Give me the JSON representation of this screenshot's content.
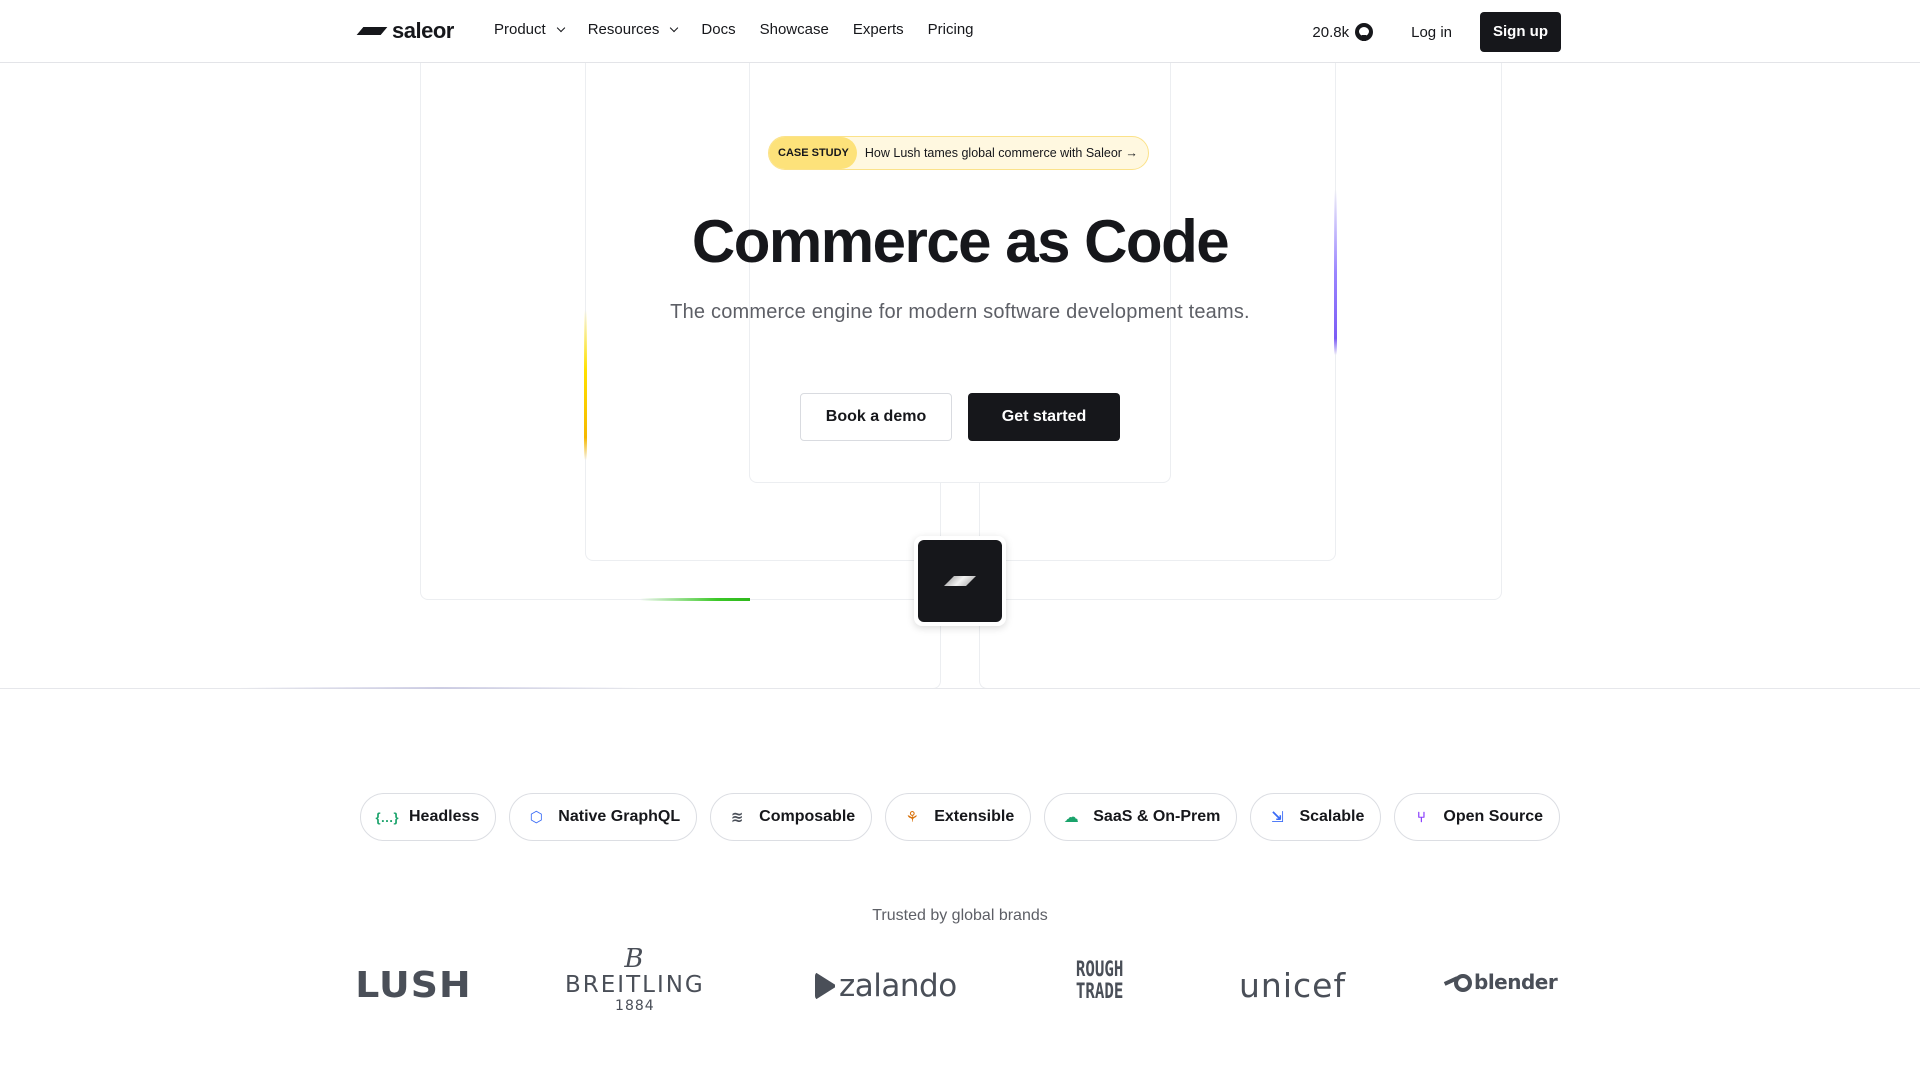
{
  "nav": {
    "brand": "saleor",
    "links": [
      {
        "label": "Product",
        "dropdown": true
      },
      {
        "label": "Resources",
        "dropdown": true
      },
      {
        "label": "Docs",
        "dropdown": false
      },
      {
        "label": "Showcase",
        "dropdown": false
      },
      {
        "label": "Experts",
        "dropdown": false
      },
      {
        "label": "Pricing",
        "dropdown": false
      }
    ],
    "github_stars": "20.8k",
    "github_icon": "github-icon",
    "login_label": "Log in",
    "signup_label": "Sign up"
  },
  "hero": {
    "badge_tag": "CASE STUDY",
    "badge_text": "How Lush tames global commerce with Saleor →",
    "title": "Commerce as Code",
    "subtitle": "The commerce engine for modern software development teams.",
    "primary_cta": "Get started",
    "secondary_cta": "Book a demo",
    "accent_colors": {
      "yellow": "#ffe100",
      "purple": "#9b86ff",
      "green": "#3cc828"
    }
  },
  "features": [
    {
      "label": "Headless",
      "icon": "curly-braces-icon",
      "glyph": "{…}",
      "color": "#1aa36b"
    },
    {
      "label": "Native GraphQL",
      "icon": "graphql-icon",
      "glyph": "⬡",
      "color": "#3b6cf6"
    },
    {
      "label": "Composable",
      "icon": "layers-icon",
      "glyph": "≋",
      "color": "#4a4f58"
    },
    {
      "label": "Extensible",
      "icon": "webhook-icon",
      "glyph": "⚘",
      "color": "#d9730d"
    },
    {
      "label": "SaaS & On-Prem",
      "icon": "cloud-server-icon",
      "glyph": "☁",
      "color": "#1aa36b"
    },
    {
      "label": "Scalable",
      "icon": "scale-arrow-icon",
      "glyph": "⇲",
      "color": "#3b6cf6"
    },
    {
      "label": "Open Source",
      "icon": "git-branch-icon",
      "glyph": "⑂",
      "color": "#8a3ffc"
    }
  ],
  "brands": {
    "heading": "Trusted by global brands",
    "items": [
      {
        "name": "LUSH"
      },
      {
        "name": "BREITLING",
        "mark": "B",
        "year": "1884"
      },
      {
        "name": "zalando"
      },
      {
        "name": "ROUGH TRADE",
        "line1": "ROUGH",
        "line2": "TRADE"
      },
      {
        "name": "unicef"
      },
      {
        "name": "blender"
      }
    ]
  }
}
